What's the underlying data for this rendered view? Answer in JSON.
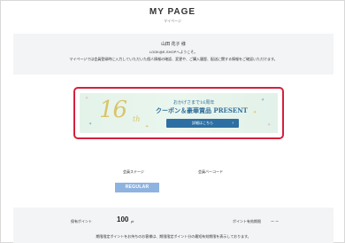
{
  "header": {
    "title": "MY PAGE",
    "subtitle": "マイページ"
  },
  "greeting": {
    "name": "山田 花子 様",
    "welcome": "LOOK@E-SHOPへようこそ。",
    "note": "マイページでは会員登録時に入力していただいた個人情報の確認、変更や、ご購入履歴、配送に関する情報をご確認いただけます。"
  },
  "banner": {
    "anniversary_number": "16",
    "anniversary_suffix": "th",
    "small_text": "おかげさまで16周年",
    "headline": "クーポン＆豪華賞品 PRESENT",
    "detail_button": "詳細はこちら",
    "chevron_icon": "chevron-right-icon",
    "highlight_color": "#d4213d"
  },
  "member": {
    "stage_label": "会員ステージ",
    "barcode_label": "会員バーコード",
    "stage": "REGULAR",
    "stage_color": "#8fb3e0"
  },
  "points": {
    "label": "保有ポイント",
    "value": "100",
    "unit": "pt",
    "expiry_label": "ポイント有効期限",
    "expiry_value": "ー ー",
    "note": "期限限定ポイントをお持ちのお客様は、期限限定ポイント分の最短有効期限を表示しております。"
  }
}
